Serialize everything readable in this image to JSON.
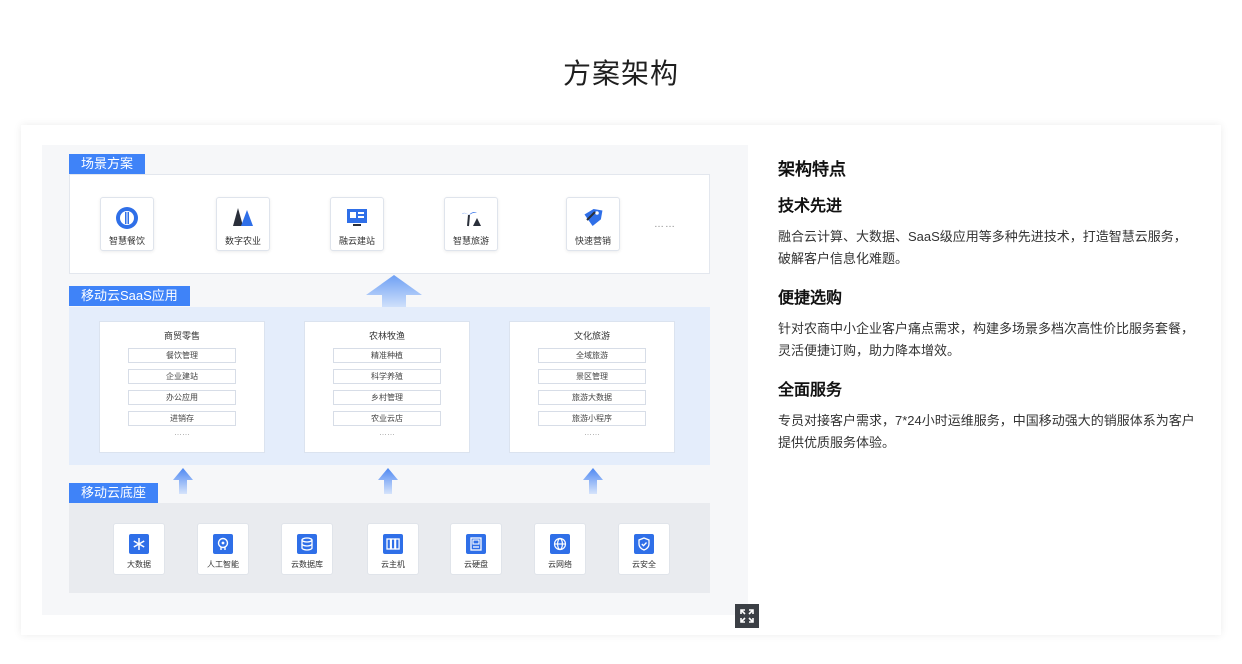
{
  "page_title": "方案架构",
  "diagram": {
    "scene": {
      "label": "场景方案",
      "items": [
        {
          "label": "智慧餐饮",
          "icon": "restaurant-icon"
        },
        {
          "label": "数字农业",
          "icon": "tree-icon"
        },
        {
          "label": "融云建站",
          "icon": "website-icon"
        },
        {
          "label": "智慧旅游",
          "icon": "palm-tree-icon"
        },
        {
          "label": "快速营销",
          "icon": "tag-icon"
        }
      ],
      "more": "……"
    },
    "saas": {
      "label": "移动云SaaS应用",
      "columns": [
        {
          "title": "商贸零售",
          "rows": [
            "餐饮管理",
            "企业建站",
            "办公应用",
            "进销存"
          ],
          "more": "……"
        },
        {
          "title": "农林牧渔",
          "rows": [
            "精准种植",
            "科学养殖",
            "乡村管理",
            "农业云店"
          ],
          "more": "……"
        },
        {
          "title": "文化旅游",
          "rows": [
            "全域旅游",
            "景区管理",
            "旅游大数据",
            "旅游小程序"
          ],
          "more": "……"
        }
      ]
    },
    "base": {
      "label": "移动云底座",
      "items": [
        {
          "label": "大数据",
          "icon": "snowflake-icon"
        },
        {
          "label": "人工智能",
          "icon": "brain-icon"
        },
        {
          "label": "云数据库",
          "icon": "database-icon"
        },
        {
          "label": "云主机",
          "icon": "server-icon"
        },
        {
          "label": "云硬盘",
          "icon": "disk-icon"
        },
        {
          "label": "云网络",
          "icon": "globe-icon"
        },
        {
          "label": "云安全",
          "icon": "shield-icon"
        }
      ]
    },
    "expand_icon": "expand-icon"
  },
  "features": {
    "heading": "架构特点",
    "items": [
      {
        "title": "技术先进",
        "desc": "融合云计算、大数据、SaaS级应用等多种先进技术，打造智慧云服务，破解客户信息化难题。"
      },
      {
        "title": "便捷选购",
        "desc": "针对农商中小企业客户痛点需求，构建多场景多档次高性价比服务套餐，灵活便捷订购，助力降本增效。"
      },
      {
        "title": "全面服务",
        "desc": "专员对接客户需求，7*24小时运维服务，中国移动强大的销服体系为客户提供优质服务体验。"
      }
    ]
  },
  "colors": {
    "accent": "#3f83f8",
    "icon_blue": "#2f6fe8",
    "saas_bg": "#e4edfb"
  }
}
